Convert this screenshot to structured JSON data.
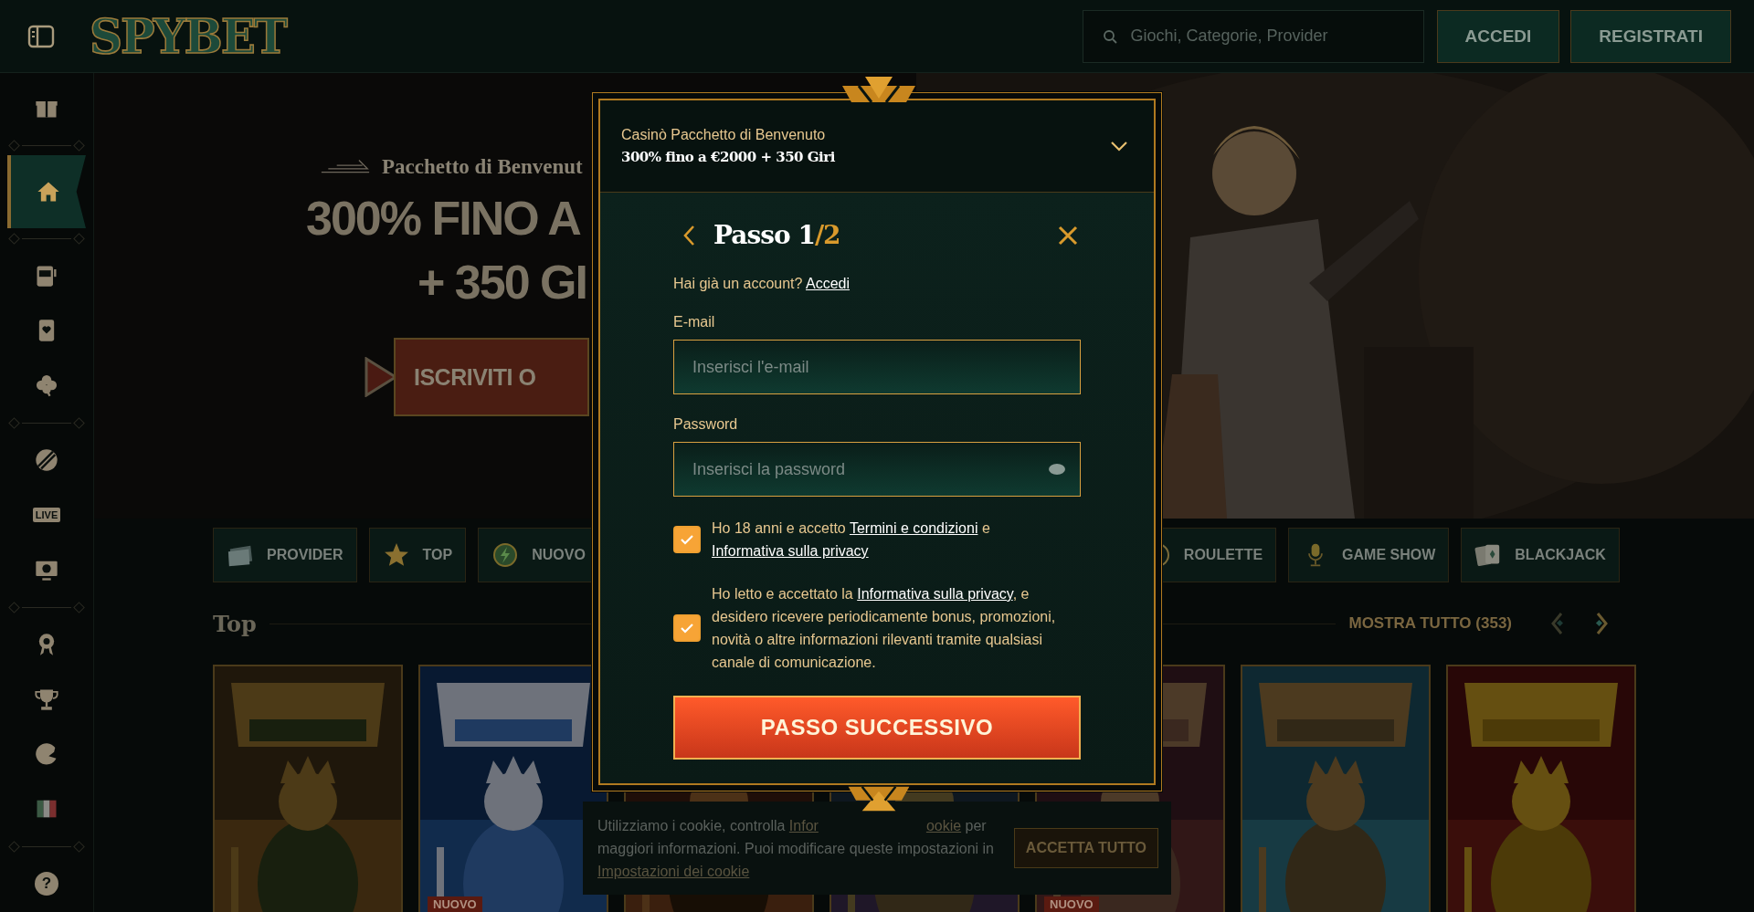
{
  "header": {
    "logo": "SPYBET",
    "search": {
      "placeholder": "Giochi, Categorie, Provider"
    },
    "buttons": [
      "ACCEDI",
      "REGISTRATI"
    ]
  },
  "sidebar": {
    "groups": [
      [
        {
          "kind": "gift",
          "selected": false
        }
      ],
      [
        {
          "kind": "home",
          "selected": true
        }
      ],
      [
        {
          "kind": "slots",
          "selected": false
        },
        {
          "kind": "cards",
          "selected": false
        },
        {
          "kind": "clover",
          "selected": false
        }
      ],
      [
        {
          "kind": "sports",
          "selected": false
        },
        {
          "kind": "live",
          "label": "LIVE",
          "selected": false
        },
        {
          "kind": "virtual",
          "selected": false
        }
      ],
      [
        {
          "kind": "badge",
          "selected": false
        },
        {
          "kind": "trophy",
          "selected": false
        },
        {
          "kind": "crescent",
          "selected": false
        },
        {
          "kind": "flag",
          "selected": false
        }
      ],
      [
        {
          "kind": "help",
          "label": "?",
          "selected": false
        }
      ]
    ]
  },
  "hero": {
    "kicker": "Pacchetto di Benvenut",
    "headline": [
      "300% FINO A",
      "+ 350 GI"
    ],
    "cta": "ISCRIVITI O"
  },
  "categories": [
    {
      "kind": "provider",
      "label": "PROVIDER"
    },
    {
      "kind": "top",
      "label": "TOP"
    },
    {
      "kind": "new",
      "label": "NUOVO"
    },
    {
      "kind": "roulette",
      "label": "ROULETTE"
    },
    {
      "kind": "gameshow",
      "label": "GAME SHOW"
    },
    {
      "kind": "blackjack",
      "label": "BLACKJACK"
    }
  ],
  "section": {
    "title": "Top",
    "show_all": "MOSTRA TUTTO (353)"
  },
  "tiles": [
    {
      "kind": "picture"
    },
    {
      "kind": "picture",
      "badge": "NUOVO"
    },
    {
      "kind": "picture"
    },
    {
      "kind": "picture"
    },
    {
      "kind": "picture",
      "badge": "NUOVO"
    },
    {
      "kind": "picture"
    },
    {
      "kind": "picture"
    }
  ],
  "modal": {
    "offer": {
      "title": "Casinò Pacchetto di Benvenuto",
      "subtitle": "300% fino a €2000 + 350 Giri",
      "expanded": false
    },
    "step": {
      "label": "Passo 1",
      "total": "/2"
    },
    "login_prompt": {
      "text": "Hai già un account?",
      "link": "Accedi"
    },
    "fields": [
      {
        "kind": "email",
        "label": "E-mail",
        "placeholder": "Inserisci l'e-mail"
      },
      {
        "kind": "password",
        "label": "Password",
        "placeholder": "Inserisci la password"
      }
    ],
    "consents": [
      {
        "checked": true,
        "parts": [
          {
            "kind": "text",
            "text": "Ho 18 anni e accetto "
          },
          {
            "kind": "link",
            "text": "Termini e condizioni"
          },
          {
            "kind": "text",
            "text": " e "
          },
          {
            "kind": "link",
            "text": "Informativa sulla privacy"
          }
        ]
      },
      {
        "checked": true,
        "parts": [
          {
            "kind": "text",
            "text": "Ho letto e accettato la "
          },
          {
            "kind": "link",
            "text": "Informativa sulla privacy"
          },
          {
            "kind": "text",
            "text": ", e desidero ricevere periodicamente bonus, promozioni, novità o altre informazioni rilevanti tramite qualsiasi canale di comunicazione."
          }
        ]
      }
    ],
    "submit": "PASSO SUCCESSIVO"
  },
  "cookie_banner": {
    "lines": [
      [
        {
          "kind": "text",
          "text": "Utilizziamo i cookie, controlla "
        },
        {
          "kind": "link",
          "text": "Infor"
        },
        {
          "kind": "link",
          "text": "ookie"
        },
        {
          "kind": "text",
          "text": " per"
        }
      ],
      [
        {
          "kind": "text",
          "text": "maggiori informazioni. Puoi modificare queste impostazioni in"
        }
      ],
      [
        {
          "kind": "link",
          "text": "Impostazioni dei cookie"
        }
      ]
    ],
    "button": "ACCETTA TUTTO"
  }
}
